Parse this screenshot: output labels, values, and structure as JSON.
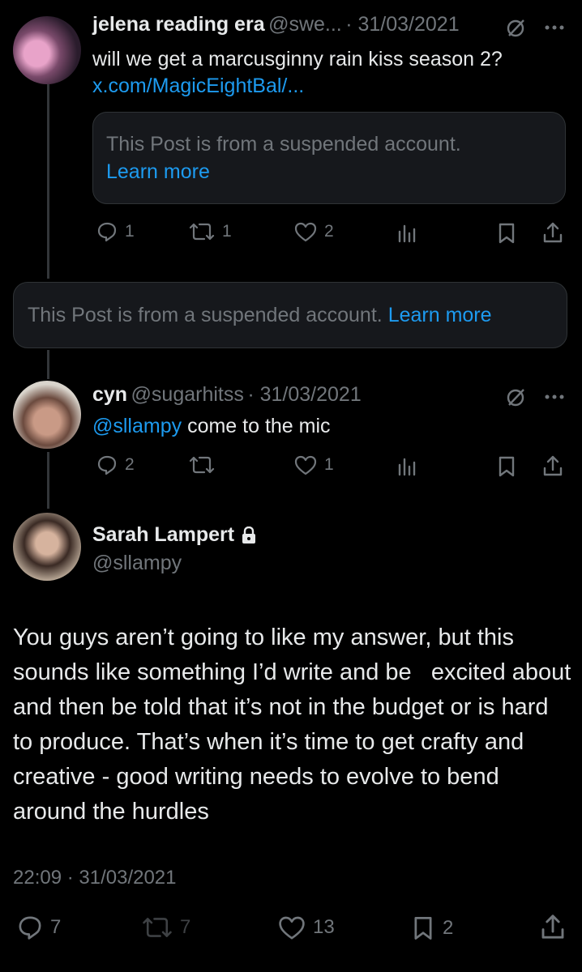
{
  "tweet1": {
    "name": "jelena reading era",
    "handle": "@swe...",
    "date": "· 31/03/2021",
    "text": "will we get a marcusginny rain kiss season 2?",
    "link": "x.com/MagicEightBal/...",
    "quote_text": "This Post is from a suspended account.",
    "quote_learn": "Learn more",
    "replies": "1",
    "reposts": "1",
    "likes": "2"
  },
  "suspended_row": {
    "text": "This Post is from a suspended account.",
    "learn": "Learn more"
  },
  "tweet2": {
    "name": "cyn",
    "handle": "@sugarhitss",
    "date": "· 31/03/2021",
    "mention": "@sllampy",
    "text": " come to the mic",
    "replies": "2",
    "reposts": "",
    "likes": "1"
  },
  "main": {
    "name": "Sarah Lampert",
    "handle": "@sllampy",
    "text": "You guys aren’t going to like my answer, but this sounds like something I’d write and be   excited about and then be told that it’s not in the budget or is hard to produce. That’s when it’s time to get crafty and creative - good writing needs to evolve to bend around the hurdles",
    "timestamp": "22:09 · 31/03/2021",
    "replies": "7",
    "reposts": "7",
    "likes": "13",
    "bookmarks": "2"
  },
  "colors": {
    "accent": "#1d9bf0",
    "muted": "#71767b",
    "text": "#e7e9ea"
  },
  "icons": [
    "reply-icon",
    "repost-icon",
    "like-icon",
    "views-icon",
    "bookmark-icon",
    "share-icon",
    "grok-icon",
    "more-icon",
    "lock-icon"
  ]
}
